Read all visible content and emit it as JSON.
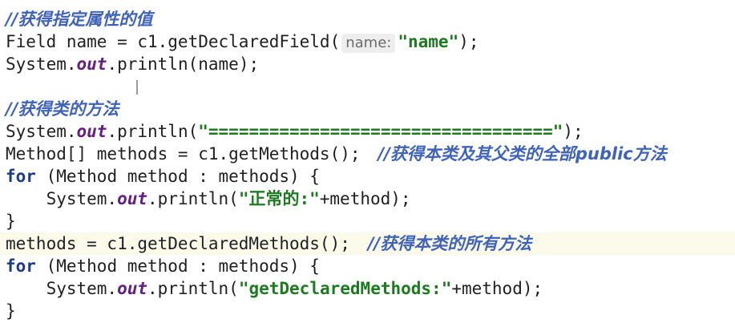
{
  "code": {
    "comment_get_field": "//获得指定属性的值",
    "comment_get_class_methods": "//获得类的方法",
    "comment_getmethods_note": "//获得本类及其父类的全部public方法",
    "comment_declared_note": "//获得本类的所有方法",
    "tok_field": "Field name = c1.getDeclaredField(",
    "hint_name": "name:",
    "str_name": "\"name\"",
    "tok_close_semicolon": ");",
    "tok_system": "System.",
    "tok_out": "out",
    "tok_println_name": ".println(name);",
    "tok_println_open": ".println(",
    "str_separator": "\"==================================\"",
    "tok_method_arr": "Method[] methods = c1.getMethods();",
    "kw_for": "for",
    "tok_for_rest": " (Method method : methods) {",
    "tok_indent": "    ",
    "str_normal": "\"正常的:\"",
    "tok_plus_method": "+method);",
    "tok_brace_close": "}",
    "tok_declared": "methods = c1.getDeclaredMethods();",
    "str_declared": "\"getDeclaredMethods:\""
  }
}
